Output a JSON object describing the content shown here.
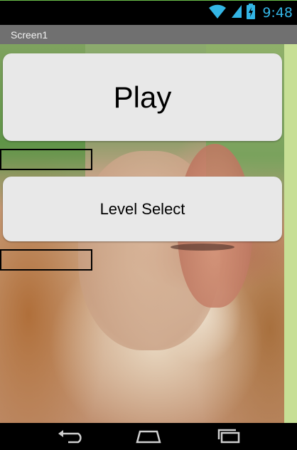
{
  "status_bar": {
    "time": "9:48",
    "icons": [
      "wifi-icon",
      "cell-signal-icon",
      "battery-charging-icon"
    ]
  },
  "title_bar": {
    "title": "Screen1"
  },
  "main": {
    "play_button_label": "Play",
    "level_select_button_label": "Level Select",
    "background_image": "proboscis-monkey-photo"
  },
  "nav_bar": {
    "icons": [
      "back-icon",
      "home-icon",
      "recent-apps-icon"
    ]
  },
  "colors": {
    "status_time": "#33b5e5",
    "title_bar": "#707070",
    "button_bg": "#e8e8e8",
    "content_edge": "#c7df95"
  }
}
